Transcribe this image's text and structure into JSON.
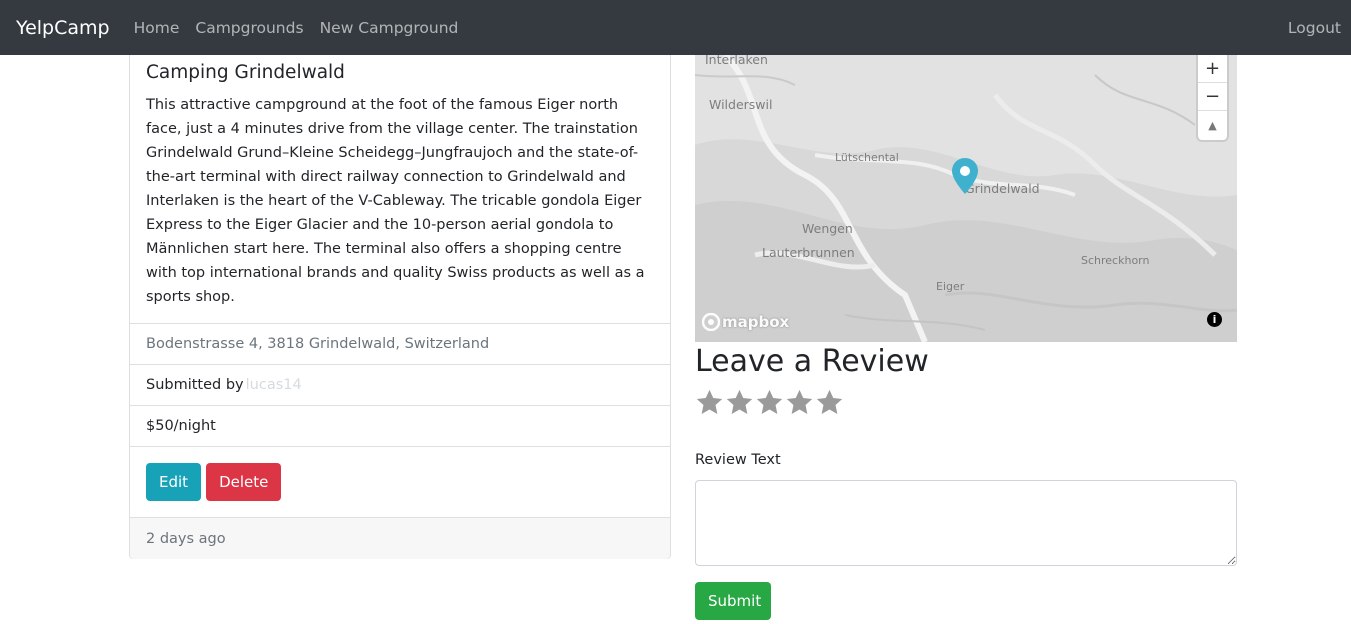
{
  "navbar": {
    "brand": "YelpCamp",
    "links": [
      "Home",
      "Campgrounds",
      "New Campground"
    ],
    "logout": "Logout"
  },
  "campground": {
    "title": "Camping Grindelwald",
    "description": "This attractive campground at the foot of the famous Eiger north face, just a 4 minutes drive from the village center. The trainstation Grindelwald Grund–Kleine Scheidegg–Jungfraujoch and the state-of-the-art terminal with direct railway connection to Grindelwald and Interlaken is the heart of the V-Cableway. The tricable gondola Eiger Express to the Eiger Glacier and the 10-person aerial gondola to Männlichen start here. The terminal also offers a shopping centre with top international brands and quality Swiss products as well as a sports shop.",
    "location": "Bodenstrasse 4, 3818 Grindelwald, Switzerland",
    "submitted_prefix": "Submitted by",
    "submitted_user": "lucas14",
    "price": "$50/night",
    "edit_label": "Edit",
    "delete_label": "Delete",
    "footer": "2 days ago"
  },
  "map": {
    "labels": [
      "Interlaken",
      "Wilderswil",
      "Lütschental",
      "Grindelwald",
      "Wengen",
      "Lauterbrunnen",
      "Schreckhorn",
      "Eiger"
    ],
    "zoom_in": "+",
    "zoom_out": "−",
    "compass": "▲",
    "attribution_logo": "mapbox",
    "info": "i"
  },
  "review": {
    "title": "Leave a Review",
    "rating": 0,
    "max_rating": 5,
    "label": "Review Text",
    "text_value": "",
    "submit_label": "Submit"
  },
  "colors": {
    "navbar": "#343a40",
    "info": "#17a2b8",
    "danger": "#dc3545",
    "success": "#28a745",
    "marker": "#3fb1ce",
    "star_empty": "#9a9a9a"
  },
  "icons": {
    "star": "star-icon",
    "marker": "map-marker-icon",
    "mapbox": "mapbox-logo-icon",
    "info": "info-icon"
  }
}
